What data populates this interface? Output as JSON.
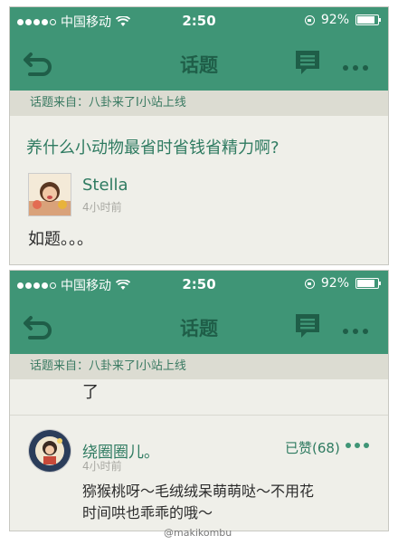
{
  "status_bar": {
    "carrier": "中国移动",
    "time": "2:50",
    "battery": "92%"
  },
  "nav": {
    "title": "话题"
  },
  "source_label": "话题来自：八卦来了I小站上线",
  "post": {
    "title": "养什么小动物最省时省钱省精力啊?",
    "author": "Stella",
    "time_ago": "4小时前",
    "body": "如题。。。"
  },
  "screen_b": {
    "partial_text": "了",
    "comment": {
      "author": "绕圈圈儿。",
      "time_ago": "4小时前",
      "liked": "已赞(68)",
      "body_line1": "猕猴桃呀～毛绒绒呆萌萌哒～不用花",
      "body_line2": "时间哄也乖乖的哦～"
    }
  },
  "watermark": "@makikombu",
  "colors": {
    "header": "#3f9576",
    "accent": "#2f7b61",
    "background": "#efefe9"
  }
}
